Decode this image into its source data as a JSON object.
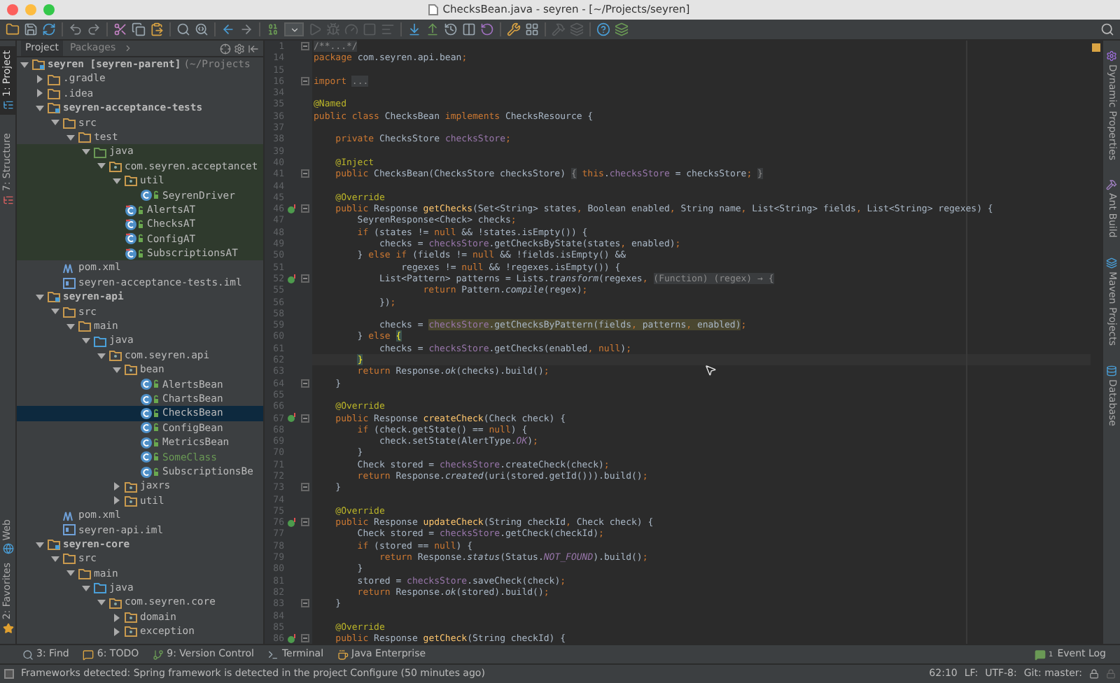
{
  "window": {
    "title": "ChecksBean.java - seyren - [~/Projects/seyren]"
  },
  "left_strip": [
    {
      "label": "1: Project",
      "selected": true
    },
    {
      "label": "7: Structure",
      "selected": false
    },
    {
      "label": "Web",
      "selected": false
    },
    {
      "label": "2: Favorites",
      "selected": false
    }
  ],
  "project_panel": {
    "tabs": [
      {
        "label": "Project",
        "selected": true
      },
      {
        "label": "Packages",
        "selected": false
      }
    ],
    "tree": [
      {
        "kind": "module",
        "label": "seyren [seyren-parent]",
        "path": "(~/Projects",
        "expanded": true,
        "selected": false,
        "children": [
          {
            "kind": "folder",
            "label": ".gradle",
            "expanded": false,
            "selected": false
          },
          {
            "kind": "folder",
            "label": ".idea",
            "expanded": false,
            "selected": false
          },
          {
            "kind": "module",
            "label": "seyren-acceptance-tests",
            "expanded": true,
            "selected": false,
            "children": [
              {
                "kind": "folder",
                "label": "src",
                "expanded": true,
                "selected": false,
                "children": [
                  {
                    "kind": "folder",
                    "label": "test",
                    "expanded": true,
                    "selected": false,
                    "children": [
                      {
                        "kind": "testroot",
                        "label": "java",
                        "expanded": true,
                        "selected": false,
                        "children": [
                          {
                            "kind": "package",
                            "label": "com.seyren.acceptancet",
                            "expanded": true,
                            "selected": false,
                            "children": [
                              {
                                "kind": "package",
                                "label": "util",
                                "expanded": true,
                                "selected": false,
                                "children": [
                                  {
                                    "kind": "class",
                                    "label": "SeyrenDriver",
                                    "selected": false
                                  }
                                ]
                              },
                              {
                                "kind": "testclass",
                                "label": "AlertsAT",
                                "selected": false
                              },
                              {
                                "kind": "testclass",
                                "label": "ChecksAT",
                                "selected": false
                              },
                              {
                                "kind": "testclass",
                                "label": "ConfigAT",
                                "selected": false
                              },
                              {
                                "kind": "testclass",
                                "label": "SubscriptionsAT",
                                "selected": false
                              }
                            ]
                          }
                        ]
                      }
                    ]
                  }
                ]
              },
              {
                "kind": "xml",
                "label": "pom.xml",
                "selected": false
              },
              {
                "kind": "iml",
                "label": "seyren-acceptance-tests.iml",
                "selected": false
              }
            ]
          },
          {
            "kind": "module",
            "label": "seyren-api",
            "expanded": true,
            "selected": false,
            "children": [
              {
                "kind": "folder",
                "label": "src",
                "expanded": true,
                "selected": false,
                "children": [
                  {
                    "kind": "folder",
                    "label": "main",
                    "expanded": true,
                    "selected": false,
                    "children": [
                      {
                        "kind": "srcroot",
                        "label": "java",
                        "expanded": true,
                        "selected": false,
                        "children": [
                          {
                            "kind": "package",
                            "label": "com.seyren.api",
                            "expanded": true,
                            "selected": false,
                            "children": [
                              {
                                "kind": "package",
                                "label": "bean",
                                "expanded": true,
                                "selected": false,
                                "children": [
                                  {
                                    "kind": "class",
                                    "label": "AlertsBean",
                                    "added": false,
                                    "selected": false
                                  },
                                  {
                                    "kind": "class",
                                    "label": "ChartsBean",
                                    "added": false,
                                    "selected": false
                                  },
                                  {
                                    "kind": "class",
                                    "label": "ChecksBean",
                                    "added": false,
                                    "selected": true
                                  },
                                  {
                                    "kind": "class",
                                    "label": "ConfigBean",
                                    "added": false,
                                    "selected": false
                                  },
                                  {
                                    "kind": "class",
                                    "label": "MetricsBean",
                                    "added": false,
                                    "selected": false
                                  },
                                  {
                                    "kind": "class",
                                    "label": "SomeClass",
                                    "added": true,
                                    "selected": false
                                  },
                                  {
                                    "kind": "class",
                                    "label": "SubscriptionsBe",
                                    "added": false,
                                    "selected": false
                                  }
                                ]
                              },
                              {
                                "kind": "package",
                                "label": "jaxrs",
                                "expanded": false,
                                "selected": false
                              },
                              {
                                "kind": "package",
                                "label": "util",
                                "expanded": false,
                                "selected": false
                              }
                            ]
                          }
                        ]
                      }
                    ]
                  }
                ]
              },
              {
                "kind": "xml",
                "label": "pom.xml",
                "selected": false
              },
              {
                "kind": "iml",
                "label": "seyren-api.iml",
                "selected": false
              }
            ]
          },
          {
            "kind": "module",
            "label": "seyren-core",
            "expanded": true,
            "selected": false,
            "children": [
              {
                "kind": "folder",
                "label": "src",
                "expanded": true,
                "selected": false,
                "children": [
                  {
                    "kind": "folder",
                    "label": "main",
                    "expanded": true,
                    "selected": false,
                    "children": [
                      {
                        "kind": "srcroot",
                        "label": "java",
                        "expanded": true,
                        "selected": false,
                        "children": [
                          {
                            "kind": "package",
                            "label": "com.seyren.core",
                            "expanded": true,
                            "selected": false,
                            "children": [
                              {
                                "kind": "package",
                                "label": "domain",
                                "expanded": false,
                                "selected": false
                              },
                              {
                                "kind": "package",
                                "label": "exception",
                                "expanded": false,
                                "selected": false
                              }
                            ]
                          }
                        ]
                      }
                    ]
                  }
                ]
              }
            ]
          }
        ]
      }
    ]
  },
  "editor": {
    "lines": [
      {
        "number": "1",
        "fold": true,
        "marker": false,
        "current": false,
        "tokens": [
          {
            "kind": "h",
            "text": "/**...*/"
          }
        ]
      },
      {
        "number": "14",
        "fold": false,
        "marker": false,
        "current": false,
        "tokens": [
          {
            "kind": "kw",
            "text": "package"
          },
          {
            "kind": "p",
            "text": " com.seyren.api.bean"
          },
          {
            "kind": "kw",
            "text": ";"
          }
        ]
      },
      {
        "number": "15",
        "fold": false,
        "marker": false,
        "current": false
      },
      {
        "number": "16",
        "fold": true,
        "marker": false,
        "current": false,
        "tokens": [
          {
            "kind": "kw",
            "text": "import "
          },
          {
            "kind": "h",
            "text": "..."
          }
        ]
      },
      {
        "number": "34",
        "fold": false,
        "marker": false,
        "current": false
      },
      {
        "number": "35",
        "fold": false,
        "marker": false,
        "current": false,
        "tokens": [
          {
            "kind": "a",
            "text": "@Named"
          }
        ]
      },
      {
        "number": "36",
        "fold": false,
        "marker": false,
        "current": false,
        "tokens": [
          {
            "kind": "kw",
            "text": "public class "
          },
          {
            "kind": "p",
            "text": "ChecksBean"
          },
          {
            "kind": "kw",
            "text": " implements "
          },
          {
            "kind": "p",
            "text": "ChecksResource {"
          }
        ]
      },
      {
        "number": "37",
        "fold": false,
        "marker": false,
        "current": false
      },
      {
        "number": "38",
        "fold": false,
        "marker": false,
        "current": false,
        "tokens": [
          {
            "kind": "kw",
            "text": "    private "
          },
          {
            "kind": "p",
            "text": "ChecksStore "
          },
          {
            "kind": "f",
            "text": "checksStore"
          },
          {
            "kind": "kw",
            "text": ";"
          }
        ]
      },
      {
        "number": "39",
        "fold": false,
        "marker": false,
        "current": false
      },
      {
        "number": "40",
        "fold": false,
        "marker": false,
        "current": false,
        "tokens": [
          {
            "kind": "a",
            "text": "    @Inject"
          }
        ]
      },
      {
        "number": "41",
        "fold": true,
        "marker": false,
        "current": false,
        "tokens": [
          {
            "kind": "kw",
            "text": "    public "
          },
          {
            "kind": "p",
            "text": "ChecksBean(ChecksStore checksStore) "
          },
          {
            "kind": "h",
            "text": "{"
          },
          {
            "kind": "kw",
            "text": " this"
          },
          {
            "kind": "p",
            "text": "."
          },
          {
            "kind": "f",
            "text": "checksStore"
          },
          {
            "kind": "p",
            "text": " = checksStore"
          },
          {
            "kind": "kw",
            "text": "; "
          },
          {
            "kind": "h",
            "text": "}"
          }
        ]
      },
      {
        "number": "44",
        "fold": false,
        "marker": false,
        "current": false
      },
      {
        "number": "45",
        "fold": false,
        "marker": false,
        "current": false,
        "tokens": [
          {
            "kind": "a",
            "text": "    @Override"
          }
        ]
      },
      {
        "number": "46",
        "fold": true,
        "marker": true,
        "current": false,
        "tokens": [
          {
            "kind": "kw",
            "text": "    public "
          },
          {
            "kind": "p",
            "text": "Response "
          },
          {
            "kind": "m",
            "text": "getChecks"
          },
          {
            "kind": "p",
            "text": "(Set<String> states"
          },
          {
            "kind": "kw",
            "text": ", "
          },
          {
            "kind": "p",
            "text": "Boolean enabled"
          },
          {
            "kind": "kw",
            "text": ", "
          },
          {
            "kind": "p",
            "text": "String name"
          },
          {
            "kind": "kw",
            "text": ", "
          },
          {
            "kind": "p",
            "text": "List<String> fields"
          },
          {
            "kind": "kw",
            "text": ", "
          },
          {
            "kind": "p",
            "text": "List<String> regexes) {"
          }
        ]
      },
      {
        "number": "47",
        "fold": false,
        "marker": false,
        "current": false,
        "tokens": [
          {
            "kind": "p",
            "text": "        SeyrenResponse<Check> checks"
          },
          {
            "kind": "kw",
            "text": ";"
          }
        ]
      },
      {
        "number": "48",
        "fold": false,
        "marker": false,
        "current": false,
        "tokens": [
          {
            "kind": "kw",
            "text": "        if "
          },
          {
            "kind": "p",
            "text": "(states != "
          },
          {
            "kind": "kw",
            "text": "null "
          },
          {
            "kind": "p",
            "text": "&& !states.isEmpty()) {"
          }
        ]
      },
      {
        "number": "49",
        "fold": false,
        "marker": false,
        "current": false,
        "tokens": [
          {
            "kind": "p",
            "text": "            checks = "
          },
          {
            "kind": "f",
            "text": "checksStore"
          },
          {
            "kind": "p",
            "text": ".getChecksByState(states"
          },
          {
            "kind": "kw",
            "text": ", "
          },
          {
            "kind": "p",
            "text": "enabled)"
          },
          {
            "kind": "kw",
            "text": ";"
          }
        ]
      },
      {
        "number": "50",
        "fold": false,
        "marker": false,
        "current": false,
        "tokens": [
          {
            "kind": "p",
            "text": "        } "
          },
          {
            "kind": "kw",
            "text": "else if "
          },
          {
            "kind": "p",
            "text": "(fields != "
          },
          {
            "kind": "kw",
            "text": "null "
          },
          {
            "kind": "p",
            "text": "&& !fields.isEmpty() &&"
          }
        ]
      },
      {
        "number": "51",
        "fold": false,
        "marker": false,
        "current": false,
        "tokens": [
          {
            "kind": "p",
            "text": "                regexes != "
          },
          {
            "kind": "kw",
            "text": "null "
          },
          {
            "kind": "p",
            "text": "&& !regexes.isEmpty()) {"
          }
        ]
      },
      {
        "number": "52",
        "fold": true,
        "marker": true,
        "current": false,
        "tokens": [
          {
            "kind": "p",
            "text": "            List<Pattern> patterns = Lists."
          },
          {
            "kind": "i",
            "text": "transform"
          },
          {
            "kind": "p",
            "text": "(regexes"
          },
          {
            "kind": "kw",
            "text": ", "
          },
          {
            "kind": "h",
            "text": "(Function) (regex) → {"
          }
        ]
      },
      {
        "number": "55",
        "fold": false,
        "marker": false,
        "current": false,
        "tokens": [
          {
            "kind": "kw",
            "text": "                    return "
          },
          {
            "kind": "p",
            "text": "Pattern."
          },
          {
            "kind": "i",
            "text": "compile"
          },
          {
            "kind": "p",
            "text": "(regex)"
          },
          {
            "kind": "kw",
            "text": ";"
          }
        ]
      },
      {
        "number": "56",
        "fold": false,
        "marker": false,
        "current": false,
        "tokens": [
          {
            "kind": "p",
            "text": "            })"
          },
          {
            "kind": "kw",
            "text": ";"
          }
        ]
      },
      {
        "number": "58",
        "fold": false,
        "marker": false,
        "current": false
      },
      {
        "number": "59",
        "fold": false,
        "marker": false,
        "current": false,
        "tokens": [
          {
            "kind": "p",
            "text": "            checks = "
          },
          {
            "kind": "hf",
            "text": "checksStore"
          },
          {
            "kind": "hp",
            "text": ".getChecksByPattern(fields"
          },
          {
            "kind": "hk",
            "text": ", "
          },
          {
            "kind": "hp",
            "text": "patterns"
          },
          {
            "kind": "hk",
            "text": ", "
          },
          {
            "kind": "hp",
            "text": "enabled)"
          },
          {
            "kind": "kw",
            "text": ";"
          }
        ]
      },
      {
        "number": "60",
        "fold": false,
        "marker": false,
        "current": false,
        "tokens": [
          {
            "kind": "p",
            "text": "        } "
          },
          {
            "kind": "kw",
            "text": "else "
          },
          {
            "kind": "br",
            "text": "{"
          }
        ]
      },
      {
        "number": "61",
        "fold": false,
        "marker": false,
        "current": false,
        "tokens": [
          {
            "kind": "p",
            "text": "            checks = "
          },
          {
            "kind": "f",
            "text": "checksStore"
          },
          {
            "kind": "p",
            "text": ".getChecks(enabled"
          },
          {
            "kind": "kw",
            "text": ", null"
          },
          {
            "kind": "p",
            "text": ")"
          },
          {
            "kind": "kw",
            "text": ";"
          }
        ]
      },
      {
        "number": "62",
        "fold": false,
        "marker": false,
        "current": true,
        "tokens": [
          {
            "kind": "pbr",
            "text": "        }"
          }
        ]
      },
      {
        "number": "63",
        "fold": false,
        "marker": false,
        "current": false,
        "tokens": [
          {
            "kind": "kw",
            "text": "        return "
          },
          {
            "kind": "p",
            "text": "Response."
          },
          {
            "kind": "i",
            "text": "ok"
          },
          {
            "kind": "p",
            "text": "(checks).build()"
          },
          {
            "kind": "kw",
            "text": ";"
          }
        ]
      },
      {
        "number": "64",
        "fold": true,
        "marker": false,
        "current": false,
        "tokens": [
          {
            "kind": "p",
            "text": "    }"
          }
        ]
      },
      {
        "number": "65",
        "fold": false,
        "marker": false,
        "current": false
      },
      {
        "number": "66",
        "fold": false,
        "marker": false,
        "current": false,
        "tokens": [
          {
            "kind": "a",
            "text": "    @Override"
          }
        ]
      },
      {
        "number": "67",
        "fold": true,
        "marker": true,
        "current": false,
        "tokens": [
          {
            "kind": "kw",
            "text": "    public "
          },
          {
            "kind": "p",
            "text": "Response "
          },
          {
            "kind": "m",
            "text": "createCheck"
          },
          {
            "kind": "p",
            "text": "(Check check) {"
          }
        ]
      },
      {
        "number": "68",
        "fold": false,
        "marker": false,
        "current": false,
        "tokens": [
          {
            "kind": "kw",
            "text": "        if "
          },
          {
            "kind": "p",
            "text": "(check.getState() == "
          },
          {
            "kind": "kw",
            "text": "null"
          },
          {
            "kind": "p",
            "text": ") {"
          }
        ]
      },
      {
        "number": "69",
        "fold": false,
        "marker": false,
        "current": false,
        "tokens": [
          {
            "kind": "p",
            "text": "            check.setState(AlertType."
          },
          {
            "kind": "s",
            "text": "OK"
          },
          {
            "kind": "p",
            "text": ")"
          },
          {
            "kind": "kw",
            "text": ";"
          }
        ]
      },
      {
        "number": "70",
        "fold": false,
        "marker": false,
        "current": false,
        "tokens": [
          {
            "kind": "p",
            "text": "        }"
          }
        ]
      },
      {
        "number": "71",
        "fold": false,
        "marker": false,
        "current": false,
        "tokens": [
          {
            "kind": "p",
            "text": "        Check stored = "
          },
          {
            "kind": "f",
            "text": "checksStore"
          },
          {
            "kind": "p",
            "text": ".createCheck(check)"
          },
          {
            "kind": "kw",
            "text": ";"
          }
        ]
      },
      {
        "number": "72",
        "fold": false,
        "marker": false,
        "current": false,
        "tokens": [
          {
            "kind": "kw",
            "text": "        return "
          },
          {
            "kind": "p",
            "text": "Response."
          },
          {
            "kind": "i",
            "text": "created"
          },
          {
            "kind": "p",
            "text": "(uri(stored.getId())).build()"
          },
          {
            "kind": "kw",
            "text": ";"
          }
        ]
      },
      {
        "number": "73",
        "fold": true,
        "marker": false,
        "current": false,
        "tokens": [
          {
            "kind": "p",
            "text": "    }"
          }
        ]
      },
      {
        "number": "74",
        "fold": false,
        "marker": false,
        "current": false
      },
      {
        "number": "75",
        "fold": false,
        "marker": false,
        "current": false,
        "tokens": [
          {
            "kind": "a",
            "text": "    @Override"
          }
        ]
      },
      {
        "number": "76",
        "fold": true,
        "marker": true,
        "current": false,
        "tokens": [
          {
            "kind": "kw",
            "text": "    public "
          },
          {
            "kind": "p",
            "text": "Response "
          },
          {
            "kind": "m",
            "text": "updateCheck"
          },
          {
            "kind": "p",
            "text": "(String checkId"
          },
          {
            "kind": "kw",
            "text": ", "
          },
          {
            "kind": "p",
            "text": "Check check) {"
          }
        ]
      },
      {
        "number": "77",
        "fold": false,
        "marker": false,
        "current": false,
        "tokens": [
          {
            "kind": "p",
            "text": "        Check stored = "
          },
          {
            "kind": "f",
            "text": "checksStore"
          },
          {
            "kind": "p",
            "text": ".getCheck(checkId)"
          },
          {
            "kind": "kw",
            "text": ";"
          }
        ]
      },
      {
        "number": "78",
        "fold": false,
        "marker": false,
        "current": false,
        "tokens": [
          {
            "kind": "kw",
            "text": "        if "
          },
          {
            "kind": "p",
            "text": "(stored == "
          },
          {
            "kind": "kw",
            "text": "null"
          },
          {
            "kind": "p",
            "text": ") {"
          }
        ]
      },
      {
        "number": "79",
        "fold": false,
        "marker": false,
        "current": false,
        "tokens": [
          {
            "kind": "kw",
            "text": "            return "
          },
          {
            "kind": "p",
            "text": "Response."
          },
          {
            "kind": "i",
            "text": "status"
          },
          {
            "kind": "p",
            "text": "(Status."
          },
          {
            "kind": "s",
            "text": "NOT_FOUND"
          },
          {
            "kind": "p",
            "text": ").build()"
          },
          {
            "kind": "kw",
            "text": ";"
          }
        ]
      },
      {
        "number": "80",
        "fold": false,
        "marker": false,
        "current": false,
        "tokens": [
          {
            "kind": "p",
            "text": "        }"
          }
        ]
      },
      {
        "number": "81",
        "fold": false,
        "marker": false,
        "current": false,
        "tokens": [
          {
            "kind": "p",
            "text": "        stored = "
          },
          {
            "kind": "f",
            "text": "checksStore"
          },
          {
            "kind": "p",
            "text": ".saveCheck(check)"
          },
          {
            "kind": "kw",
            "text": ";"
          }
        ]
      },
      {
        "number": "82",
        "fold": false,
        "marker": false,
        "current": false,
        "tokens": [
          {
            "kind": "kw",
            "text": "        return "
          },
          {
            "kind": "p",
            "text": "Response."
          },
          {
            "kind": "i",
            "text": "ok"
          },
          {
            "kind": "p",
            "text": "(stored).build()"
          },
          {
            "kind": "kw",
            "text": ";"
          }
        ]
      },
      {
        "number": "83",
        "fold": true,
        "marker": false,
        "current": false,
        "tokens": [
          {
            "kind": "p",
            "text": "    }"
          }
        ]
      },
      {
        "number": "84",
        "fold": false,
        "marker": false,
        "current": false
      },
      {
        "number": "85",
        "fold": false,
        "marker": false,
        "current": false,
        "tokens": [
          {
            "kind": "a",
            "text": "    @Override"
          }
        ]
      },
      {
        "number": "86",
        "fold": true,
        "marker": true,
        "current": false,
        "tokens": [
          {
            "kind": "kw",
            "text": "    public "
          },
          {
            "kind": "p",
            "text": "Response "
          },
          {
            "kind": "m",
            "text": "getCheck"
          },
          {
            "kind": "p",
            "text": "(String checkId) {"
          }
        ]
      }
    ]
  },
  "right_strip": [
    {
      "label": "Dynamic Properties"
    },
    {
      "label": "Ant Build"
    },
    {
      "label": "Maven Projects"
    },
    {
      "label": "Database"
    }
  ],
  "bottom_tools": [
    {
      "label": "3: Find"
    },
    {
      "label": "6: TODO"
    },
    {
      "label": "9: Version Control"
    },
    {
      "label": "Terminal"
    },
    {
      "label": "Java Enterprise"
    }
  ],
  "event_log": {
    "label": "Event Log",
    "count": "1"
  },
  "status_bar": {
    "message": "Frameworks detected: Spring framework is detected in the project Configure (50 minutes ago)",
    "position": "62:10",
    "line_separator": "LF:",
    "encoding": "UTF-8:",
    "branch": "Git: master:"
  }
}
